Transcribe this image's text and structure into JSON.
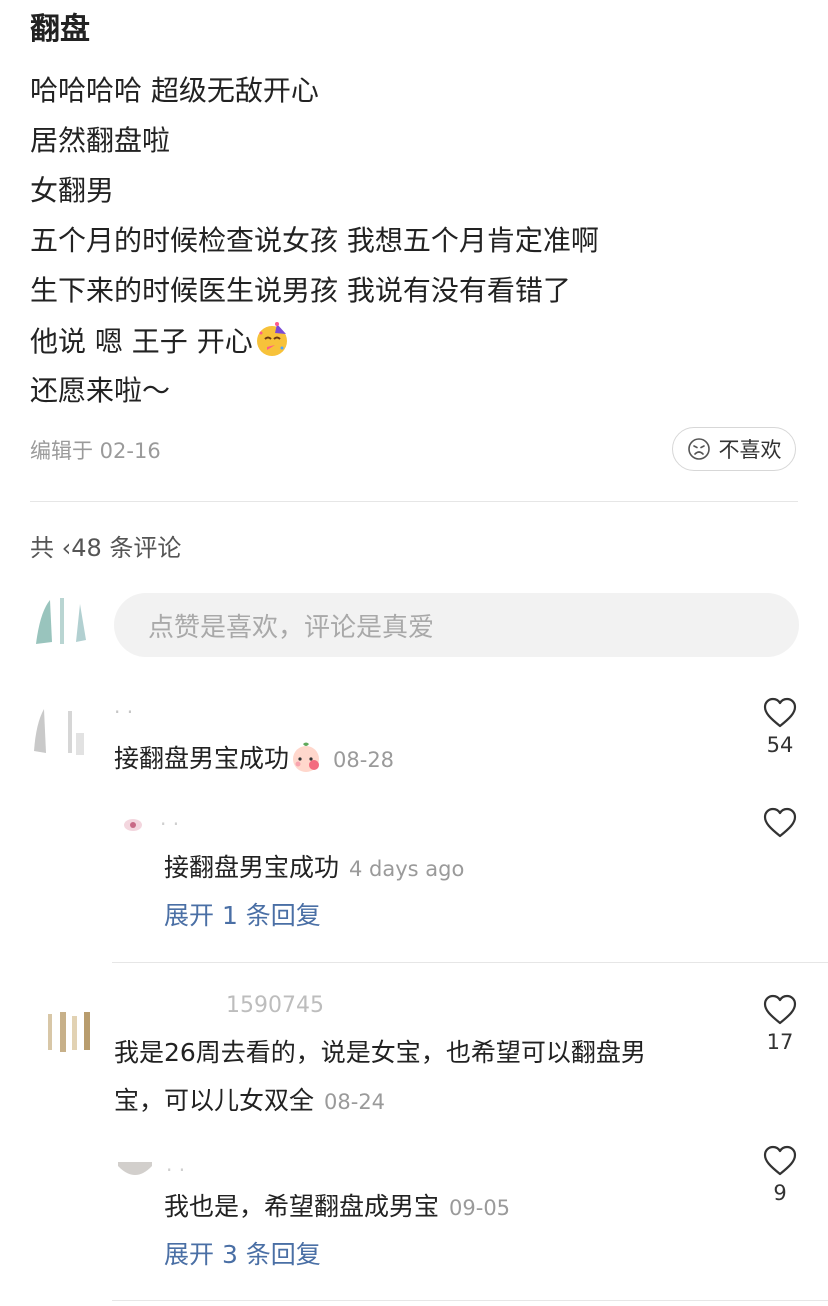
{
  "post": {
    "title": "翻盘",
    "lines": [
      "哈哈哈哈 超级无敌开心",
      "居然翻盘啦",
      "女翻男",
      "五个月的时候检查说女孩 我想五个月肯定准啊",
      "生下来的时候医生说男孩 我说有没有看错了",
      "他说 嗯 王子 开心",
      "还愿来啦～"
    ],
    "edited": "编辑于 02-16",
    "dislike_label": "不喜欢"
  },
  "comments_header": {
    "count_label": "共 ‹48 条评论"
  },
  "composer": {
    "placeholder": "点赞是喜欢，评论是真爱"
  },
  "comments": [
    {
      "text": "接翻盘男宝成功",
      "date": "08-28",
      "likes": "54",
      "reply": {
        "text": "接翻盘男宝成功",
        "date": "4 days ago"
      },
      "expand_label": "展开 1 条回复"
    },
    {
      "user": "1590745",
      "text_line1": "我是26周去看的，说是女宝，也希望可以翻盘男",
      "text_line2": "宝，可以儿女双全",
      "date": "08-24",
      "likes": "17",
      "reply": {
        "text": "我也是，希望翻盘成男宝",
        "date": "09-05",
        "likes": "9"
      },
      "expand_label": "展开 3 条回复"
    }
  ],
  "colors": {
    "text": "#222222",
    "secondary": "#9a9a9a",
    "link": "#4a6fa5",
    "composer_bg": "#f2f2f2"
  }
}
